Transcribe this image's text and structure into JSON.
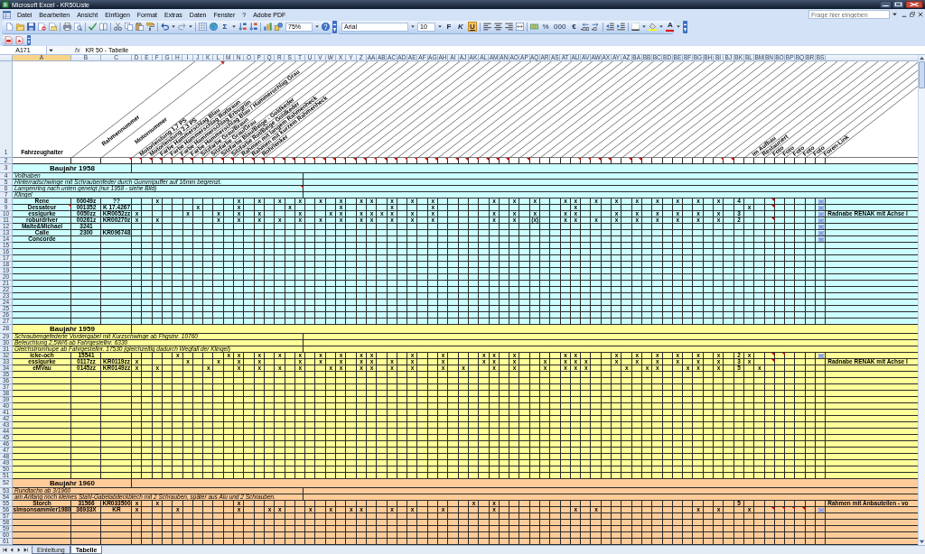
{
  "window": {
    "title": "Microsoft Excel - KR50Liste"
  },
  "menu": [
    "Datei",
    "Bearbeiten",
    "Ansicht",
    "Einfügen",
    "Format",
    "Extras",
    "Daten",
    "Fenster",
    "?",
    "Adobe PDF"
  ],
  "help_search": {
    "placeholder": "Frage hier eingeben"
  },
  "toolbar": {
    "autosum": "Σ",
    "zoom": "75%",
    "font": "Arial",
    "font_size": "10",
    "bold": {
      "label": "F",
      "on": false
    },
    "italic": {
      "label": "K",
      "on": false
    },
    "underline": {
      "label": "U",
      "on": true
    },
    "percent": "%",
    "thousands": "000",
    "euro": "€",
    "font_color": "A"
  },
  "formula_bar": {
    "name_box": "A171",
    "function_label": "fx",
    "content": "KR 50 - Tabelle"
  },
  "sheet": {
    "columns": [
      {
        "label": "A",
        "selected": true
      },
      {
        "label": "B",
        "selected": false
      },
      {
        "label": "C",
        "selected": false
      },
      {
        "label": "D",
        "selected": false
      },
      {
        "label": "E",
        "selected": false
      },
      {
        "label": "F",
        "selected": false
      },
      {
        "label": "G",
        "selected": false
      },
      {
        "label": "H",
        "selected": false
      },
      {
        "label": "I",
        "selected": false
      },
      {
        "label": "J",
        "selected": false
      },
      {
        "label": "K",
        "selected": false
      },
      {
        "label": "L",
        "selected": false
      },
      {
        "label": "M",
        "selected": false
      },
      {
        "label": "N",
        "selected": false
      },
      {
        "label": "O",
        "selected": false
      },
      {
        "label": "P",
        "selected": false
      },
      {
        "label": "Q",
        "selected": false
      },
      {
        "label": "R",
        "selected": false
      },
      {
        "label": "S",
        "selected": false
      },
      {
        "label": "T",
        "selected": false
      },
      {
        "label": "U",
        "selected": false
      },
      {
        "label": "V",
        "selected": false
      },
      {
        "label": "W",
        "selected": false
      },
      {
        "label": "X",
        "selected": false
      },
      {
        "label": "Y",
        "selected": false
      },
      {
        "label": "Z",
        "selected": false
      },
      {
        "label": "AA",
        "selected": false
      },
      {
        "label": "AB",
        "selected": false
      },
      {
        "label": "AC",
        "selected": false
      },
      {
        "label": "AD",
        "selected": false
      },
      {
        "label": "AE",
        "selected": false
      },
      {
        "label": "AF",
        "selected": false
      },
      {
        "label": "AG",
        "selected": false
      },
      {
        "label": "AH",
        "selected": false
      },
      {
        "label": "AI",
        "selected": false
      },
      {
        "label": "AJ",
        "selected": false
      },
      {
        "label": "AK",
        "selected": false
      },
      {
        "label": "AL",
        "selected": false
      },
      {
        "label": "AM",
        "selected": false
      },
      {
        "label": "AN",
        "selected": false
      },
      {
        "label": "AO",
        "selected": false
      },
      {
        "label": "AP",
        "selected": false
      },
      {
        "label": "AQ",
        "selected": false
      },
      {
        "label": "AR",
        "selected": false
      },
      {
        "label": "AS",
        "selected": false
      },
      {
        "label": "AT",
        "selected": false
      },
      {
        "label": "AU",
        "selected": false
      },
      {
        "label": "AV",
        "selected": false
      },
      {
        "label": "AW",
        "selected": false
      },
      {
        "label": "AX",
        "selected": false
      },
      {
        "label": "AY",
        "selected": false
      },
      {
        "label": "AZ",
        "selected": false
      },
      {
        "label": "BA",
        "selected": false
      },
      {
        "label": "BB",
        "selected": false
      },
      {
        "label": "BC",
        "selected": false
      },
      {
        "label": "BD",
        "selected": false
      },
      {
        "label": "BE",
        "selected": false
      },
      {
        "label": "BF",
        "selected": false
      },
      {
        "label": "BG",
        "selected": false
      },
      {
        "label": "BH",
        "selected": false
      },
      {
        "label": "BI",
        "selected": false
      },
      {
        "label": "BJ",
        "selected": false
      },
      {
        "label": "BK",
        "selected": false
      },
      {
        "label": "BL",
        "selected": false
      },
      {
        "label": "BM",
        "selected": false
      },
      {
        "label": "BN",
        "selected": false
      },
      {
        "label": "BO",
        "selected": false
      },
      {
        "label": "BP",
        "selected": false
      },
      {
        "label": "BQ",
        "selected": false
      },
      {
        "label": "BR",
        "selected": false
      },
      {
        "label": "BS",
        "selected": false
      }
    ],
    "header_row": {
      "number": "1",
      "cells": {
        "A": "Fahrzeughalter",
        "B": "Rahmennummer",
        "C": "Motornummer",
        "D": "Motorleistung 1,7 PS",
        "E": "Motorleistung 2,3 PS",
        "F": "Farbe Hammerschlag Blau",
        "G": "Farbe Hammerschlag Rotbraun",
        "H": "Farbe Hammerschlag Erbsgrün",
        "I": "Farbe Hammerschlag Blau / Hammerschlag Grau",
        "J": "Sitzfarbe Grau/Braun",
        "K": "Sitzfarbe Grau/Grau",
        "L": "Sitzfarbe Blau/Beige - Goldkeder",
        "M": "Sitzfarbe Rot/Beige Goldkeder",
        "N": "Rahmen mit langem Rahmenheck",
        "O": "Rahmen mit kurzem Rahmenheck",
        "P": "Rohrlenker",
        "BL": "im Aufbau",
        "BM": "Restauriert",
        "BN": "Foto",
        "BO": "Foto",
        "BP": "Foto",
        "BQ": "Foto",
        "BR": "Foto",
        "BS": "Foren-Link"
      },
      "comments": {
        "L": true
      }
    },
    "second_row": {
      "number": "2",
      "comments": {
        "C": true,
        "D": true,
        "E": true,
        "F": true,
        "G": true,
        "H": true,
        "I": true,
        "J": true,
        "K": true,
        "L": true,
        "M": true,
        "N": true,
        "O": true,
        "P": true,
        "Q": true,
        "R": true,
        "S": true,
        "T": true,
        "U": true,
        "V": true,
        "W": true,
        "X": true,
        "Y": true,
        "Z": true,
        "AA": true,
        "AB": true,
        "AC": true,
        "AD": true,
        "AE": true,
        "AF": true,
        "AG": true,
        "AH": true,
        "AI": true,
        "AJ": true,
        "AK": true,
        "AL": true,
        "AM": true,
        "AN": true,
        "AP": true,
        "AU": true,
        "AV": true,
        "AW": true,
        "AX": true,
        "AZ": true,
        "BA": true,
        "BI": true,
        "BJ": true
      }
    },
    "sections": [
      {
        "color": "#ccffff",
        "rows": [
          {
            "number": "3",
            "kind": "title",
            "text": "Baujahr 1958"
          },
          {
            "number": "4",
            "kind": "note",
            "text": "Vollnaben"
          },
          {
            "number": "5",
            "kind": "note",
            "text": "Hinterradschwinge mit Schraubenfeder durch Gummipuffer auf 16mm begrenzt."
          },
          {
            "number": "6",
            "kind": "note",
            "text": "Lampenring nach unten geneigt (nur 1958 - siehe Bild)",
            "comment": true
          },
          {
            "number": "7",
            "kind": "note",
            "text": "Klingel"
          },
          {
            "number": "8",
            "kind": "data",
            "cells": {
              "A": "Rene",
              "B": "00049z",
              "C": "??",
              "F": "x",
              "N": "x",
              "P": "x",
              "R": "x",
              "T": "x",
              "V": "x",
              "X": "x",
              "Z": "x",
              "AA": "x",
              "AC": "x",
              "AE": "x",
              "AG": "x",
              "AM": "x",
              "AO": "x",
              "AQ": "x",
              "AT": "x",
              "AU": "x",
              "AW": "x",
              "AY": "x",
              "BA": "x",
              "BC": "x",
              "BE": "x",
              "BG": "x",
              "BI": "x",
              "BK": "4"
            },
            "comments": {
              "BN": true
            },
            "links": {
              "BS": true
            }
          },
          {
            "number": "9",
            "kind": "data",
            "cells": {
              "A": "Dessateur",
              "B": "001352",
              "C": "K 17.4267",
              "J": "x",
              "N": "x",
              "S": "x",
              "X": "x",
              "AC": "x",
              "AG": "x",
              "AU": "x",
              "BL": "x"
            },
            "comments": {
              "A": true,
              "BN": true
            },
            "links": {
              "BS": true
            }
          },
          {
            "number": "10",
            "kind": "data",
            "cells": {
              "A": "essigurke",
              "B": "0050zz",
              "C": "KR0052zz",
              "D": "x",
              "I": "x",
              "L": "x",
              "N": "x",
              "P": "x",
              "T": "x",
              "W": "x",
              "X": "x",
              "Z": "x",
              "AA": "x",
              "AB": "x",
              "AC": "x",
              "AE": "x",
              "AG": "x",
              "AM": "x",
              "AO": "x",
              "AQ": "x",
              "AT": "x",
              "AU": "x",
              "AY": "x",
              "BA": "x",
              "BC": "x",
              "BE": "x",
              "BG": "x",
              "BI": "x",
              "BK": "3"
            },
            "links": {
              "BS": true
            },
            "remark": "Radnabe RENAK mit Achse I"
          },
          {
            "number": "11",
            "kind": "data",
            "cells": {
              "A": "roburdriver",
              "B": "00261z",
              "C": "KR00270z",
              "D": "x",
              "F": "x",
              "L": "x",
              "N": "x",
              "P": "x",
              "R": "x",
              "T": "x",
              "V": "x",
              "X": "x",
              "Z": "x",
              "AA": "x",
              "AC": "x",
              "AE": "x",
              "AG": "x",
              "AM": "x",
              "AO": "x",
              "AQ": "(x)",
              "AT": "x",
              "AU": "x",
              "AW": "x",
              "AY": "x",
              "BA": "x",
              "BC": "x",
              "BE": "x",
              "BG": "x",
              "BI": "x",
              "BK": "2"
            },
            "comments": {
              "BN": true
            },
            "links": {
              "BS": true
            }
          },
          {
            "number": "12",
            "kind": "data",
            "cells": {
              "A": "Malte&Michael",
              "B": "3241"
            },
            "links": {
              "BS": true
            }
          },
          {
            "number": "13",
            "kind": "data",
            "cells": {
              "A": "Calle",
              "B": "2300",
              "C": "KR096748"
            },
            "links": {
              "BS": true
            }
          },
          {
            "number": "14",
            "kind": "data",
            "cells": {
              "A": "Concorde"
            },
            "links": {
              "BS": true
            }
          },
          {
            "number": "15",
            "kind": "data"
          },
          {
            "number": "16",
            "kind": "data"
          },
          {
            "number": "17",
            "kind": "data"
          },
          {
            "number": "18",
            "kind": "data"
          },
          {
            "number": "19",
            "kind": "data"
          },
          {
            "number": "20",
            "kind": "data"
          },
          {
            "number": "21",
            "kind": "data"
          },
          {
            "number": "22",
            "kind": "data"
          },
          {
            "number": "23",
            "kind": "data"
          },
          {
            "number": "24",
            "kind": "data"
          },
          {
            "number": "25",
            "kind": "data"
          },
          {
            "number": "26",
            "kind": "data"
          },
          {
            "number": "27",
            "kind": "data"
          }
        ]
      },
      {
        "color": "#ffff99",
        "rows": [
          {
            "number": "28",
            "kind": "title",
            "text": "Baujahr 1959"
          },
          {
            "number": "29",
            "kind": "note",
            "text": "Schraubengefederte Vordergabel mit Kurzschwinge ab Fhgstnr. 10760"
          },
          {
            "number": "30",
            "kind": "note",
            "text": "Beleuchtung 2,5W/6 ab Fahrgestellnr. 6330"
          },
          {
            "number": "31",
            "kind": "note",
            "text": "Gleichstromhupe ab Fahrgestellnr. 17530 (gleichzeitig dadurch Wegfall der Klingel)"
          },
          {
            "number": "32",
            "kind": "data",
            "cells": {
              "A": "icke-och",
              "B": "15541",
              "H": "x",
              "M": "x",
              "N": "x",
              "P": "x",
              "R": "x",
              "T": "x",
              "V": "x",
              "X": "x",
              "Z": "x",
              "AA": "x",
              "AE": "x",
              "AH": "x",
              "AL": "x",
              "AM": "x",
              "AO": "x",
              "AT": "x",
              "AU": "x",
              "AY": "x",
              "BA": "x",
              "BC": "x",
              "BE": "x",
              "BG": "x",
              "BI": "x",
              "BK": "2",
              "BL": "x"
            },
            "comments": {
              "BN": true,
              "BO": true
            },
            "links": {
              "BS": true
            }
          },
          {
            "number": "33",
            "kind": "data",
            "cells": {
              "A": "essigurke",
              "B": "0117zz",
              "C": "KR0119zz",
              "D": "x",
              "I": "x",
              "L": "x",
              "N": "x",
              "P": "x",
              "T": "x",
              "V": "x",
              "X": "x",
              "Z": "x",
              "AA": "x",
              "AC": "x",
              "AE": "x",
              "AH": "x",
              "AL": "x",
              "AM": "x",
              "AO": "x",
              "AR": "x",
              "AT": "x",
              "AU": "x",
              "AV": "x",
              "AY": "x",
              "BA": "x",
              "BC": "x",
              "BE": "x",
              "BG": "x",
              "BI": "x",
              "BK": "3",
              "BL": "x"
            },
            "comments": {
              "BN": true
            },
            "remark": "Radnabe RENAK mit Achse I"
          },
          {
            "number": "34",
            "kind": "data",
            "cells": {
              "A": "eMVau",
              "B": "0145zz",
              "C": "KR0149zz",
              "D": "x",
              "F": "x",
              "K": "x",
              "N": "x",
              "P": "x",
              "R": "x",
              "T": "x",
              "W": "x",
              "X": "x",
              "Z": "x",
              "AA": "x",
              "AC": "x",
              "AE": "x",
              "AH": "x",
              "AJ": "x",
              "AM": "x",
              "AO": "x",
              "AR": "x",
              "AT": "x",
              "AU": "x",
              "AV": "x",
              "AZ": "x",
              "BB": "x",
              "BC": "x",
              "BF": "x",
              "BG": "x",
              "BI": "x",
              "BK": "5",
              "BM": "x"
            }
          },
          {
            "number": "35",
            "kind": "data"
          },
          {
            "number": "36",
            "kind": "data"
          },
          {
            "number": "37",
            "kind": "data"
          },
          {
            "number": "38",
            "kind": "data"
          },
          {
            "number": "39",
            "kind": "data"
          },
          {
            "number": "40",
            "kind": "data"
          },
          {
            "number": "41",
            "kind": "data"
          },
          {
            "number": "42",
            "kind": "data"
          },
          {
            "number": "43",
            "kind": "data"
          },
          {
            "number": "44",
            "kind": "data"
          },
          {
            "number": "45",
            "kind": "data"
          },
          {
            "number": "46",
            "kind": "data"
          },
          {
            "number": "47",
            "kind": "data"
          },
          {
            "number": "48",
            "kind": "data"
          },
          {
            "number": "49",
            "kind": "data"
          },
          {
            "number": "50",
            "kind": "data"
          },
          {
            "number": "51",
            "kind": "data"
          }
        ]
      },
      {
        "color": "#ffcc99",
        "rows": [
          {
            "number": "52",
            "kind": "title",
            "text": "Baujahr 1960"
          },
          {
            "number": "53",
            "kind": "note",
            "text": "Rundtacho ab 3/1960"
          },
          {
            "number": "54",
            "kind": "note",
            "text": "am Anfang noch kleines Stahl-Gabelabdeckblech mit 2 Schrauben, später aus Alu und 2 Schrauben."
          },
          {
            "number": "55",
            "kind": "data",
            "cells": {
              "A": "Storch",
              "B": "31566",
              "C": "KR033500",
              "D": "x",
              "F": "x",
              "N": "x",
              "AK": "x",
              "AM": "x",
              "BK": "5"
            },
            "remark": "Rahmen mit Anbauteilen - vo"
          },
          {
            "number": "56",
            "kind": "data",
            "cells": {
              "A": "simsonsammler1980",
              "B": "36933X",
              "C": "KR",
              "D": "x",
              "H": "x",
              "N": "x",
              "Q": "x",
              "R": "x",
              "U": "x",
              "W": "x",
              "Y": "x",
              "Z": "x",
              "AC": "x",
              "AE": "x",
              "AH": "x",
              "AM": "x",
              "AU": "x",
              "AW": "x",
              "BG": "x",
              "BI": "x",
              "BL": "x"
            },
            "comments": {
              "BN": true,
              "BO": true,
              "BP": true,
              "BQ": true
            },
            "links": {
              "BS": true
            }
          },
          {
            "number": "57",
            "kind": "data"
          },
          {
            "number": "58",
            "kind": "data"
          },
          {
            "number": "59",
            "kind": "data"
          },
          {
            "number": "60",
            "kind": "data"
          },
          {
            "number": "61",
            "kind": "data"
          }
        ]
      }
    ]
  },
  "sheet_tabs": [
    {
      "label": "Einleitung",
      "selected": false
    },
    {
      "label": "Tabelle",
      "selected": true
    }
  ]
}
